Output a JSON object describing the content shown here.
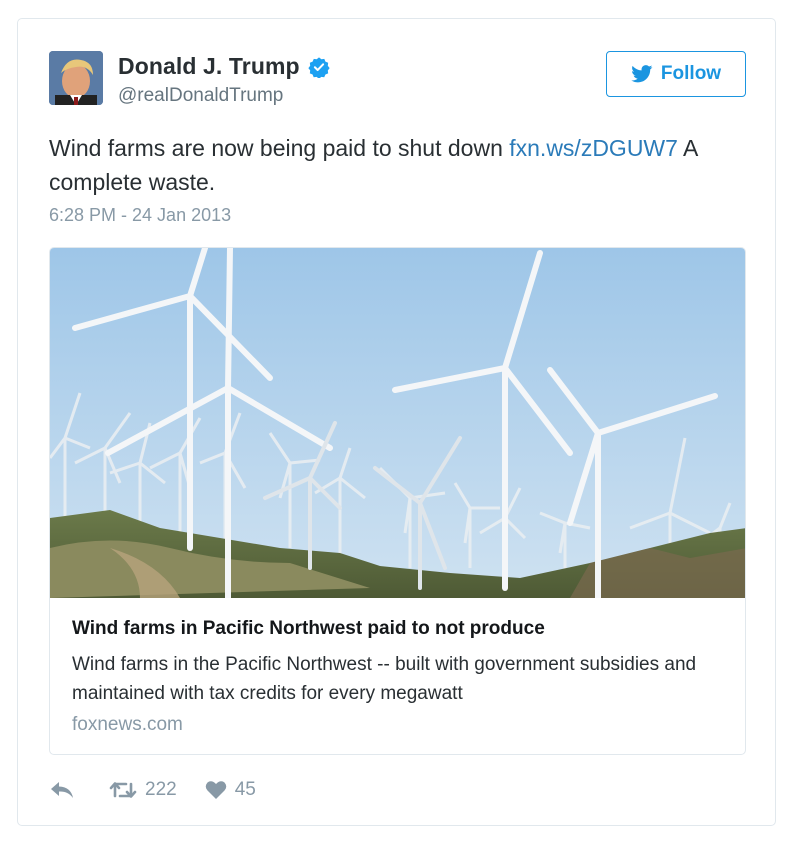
{
  "tweet": {
    "author": {
      "display_name": "Donald J. Trump",
      "handle": "@realDonaldTrump",
      "verified": true,
      "verified_icon": "verified-badge-icon"
    },
    "follow_button": {
      "label": "Follow",
      "icon": "twitter-bird-icon"
    },
    "text_before_link": "Wind farms are now being paid to shut down ",
    "link_text": "fxn.ws/zDGUW7",
    "text_after_link": " A complete waste.",
    "timestamp": "6:28 PM - 24 Jan 2013",
    "card": {
      "image": "wind-turbines-image",
      "title": "Wind farms in Pacific Northwest paid to not produce",
      "description": "Wind farms in the Pacific Northwest -- built with government subsidies and maintained with tax credits for every megawatt",
      "domain": "foxnews.com"
    },
    "actions": {
      "reply_icon": "reply-icon",
      "retweet_icon": "retweet-icon",
      "retweet_count": "222",
      "like_icon": "heart-icon",
      "like_count": "45"
    }
  },
  "colors": {
    "accent": "#1b95e0",
    "link": "#2b7bb9",
    "muted": "#8899a6",
    "text": "#292f33",
    "border": "#e1e8ed",
    "sky": "#a9cdea"
  }
}
